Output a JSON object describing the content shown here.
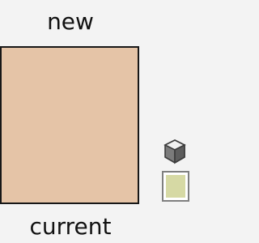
{
  "labels": {
    "new": "new",
    "current": "current"
  },
  "colors": {
    "new_color": "#e5c4a7",
    "current_color": "#e5c4a7",
    "websafe_color": "#d6d9a4"
  },
  "icons": {
    "websafe_button": "cube-icon"
  }
}
